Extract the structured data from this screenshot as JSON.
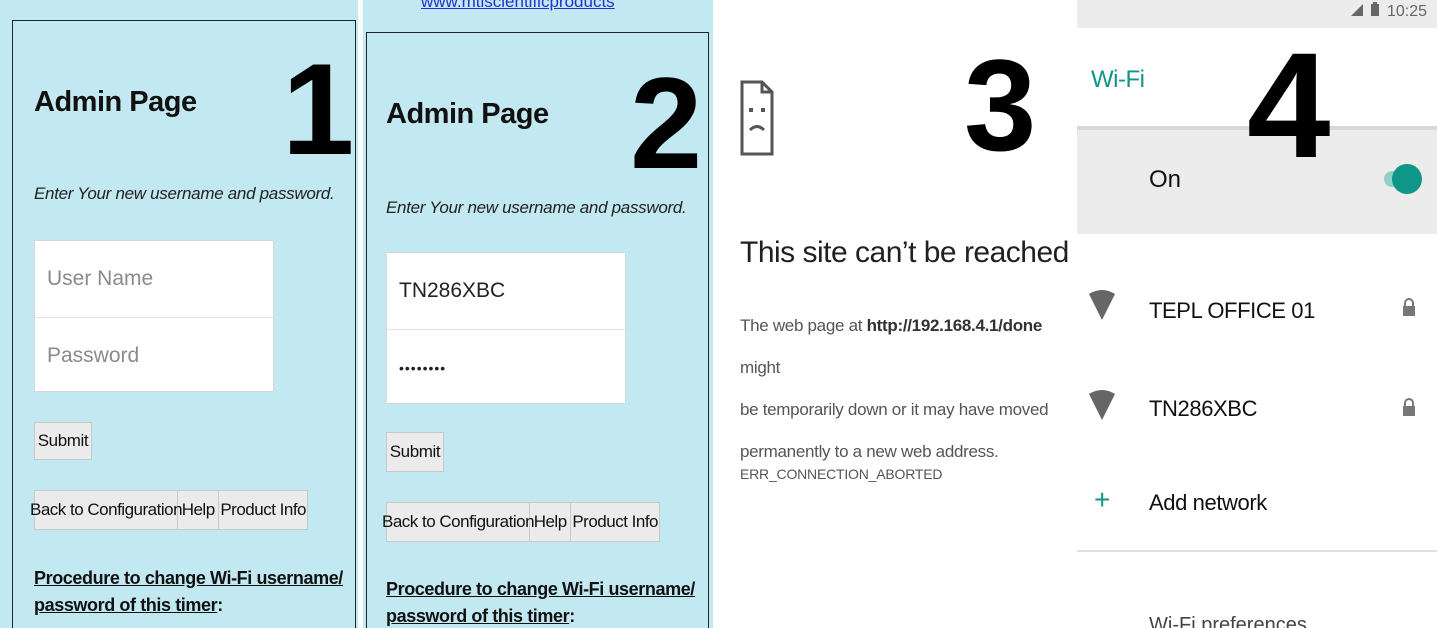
{
  "panels": {
    "p1": {
      "number": "1",
      "title": "Admin Page",
      "subtitle": "Enter Your new username and password.",
      "username_placeholder": "User Name",
      "password_placeholder": "Password",
      "submit_label": "Submit",
      "nav": [
        "Back to Configuration",
        "Help",
        "Product Info"
      ],
      "procedure_line1": "Procedure to change Wi-Fi username/",
      "procedure_line2_link": "password of this timer",
      "procedure_line2_suffix": ":"
    },
    "p2": {
      "number": "2",
      "top_link": "www.mtiscientificproducts",
      "title": "Admin Page",
      "subtitle": "Enter Your new username and password.",
      "username_value": "TN286XBC",
      "password_value": "••••••••",
      "submit_label": "Submit",
      "nav": [
        "Back to Configuration",
        "Help",
        "Product Info"
      ],
      "procedure_line1": "Procedure to change Wi-Fi username/",
      "procedure_line2_link": "password of this timer",
      "procedure_line2_suffix": ":"
    },
    "p3": {
      "number": "3",
      "icon": "sad-page-icon",
      "title": "This site can’t be reached",
      "body_prefix": "The web page at ",
      "url": "http://192.168.4.1/done",
      "body_suffix_1": " might",
      "body_line2": "be temporarily down or it may have moved",
      "body_line3": "permanently to a new web address.",
      "error_code": "ERR_CONNECTION_ABORTED"
    },
    "p4": {
      "number": "4",
      "time": "10:25",
      "title": "Wi-Fi",
      "toggle_label": "On",
      "toggle_on": true,
      "networks": [
        {
          "name": "TEPL OFFICE 01",
          "locked": true
        },
        {
          "name": "TN286XBC",
          "locked": true
        }
      ],
      "add_network_label": "Add network",
      "preferences_label": "Wi-Fi preferences"
    }
  },
  "colors": {
    "admin_bg": "#c2e8f1",
    "wifi_accent": "#0f9688",
    "wifi_header_bg": "#ececec"
  }
}
